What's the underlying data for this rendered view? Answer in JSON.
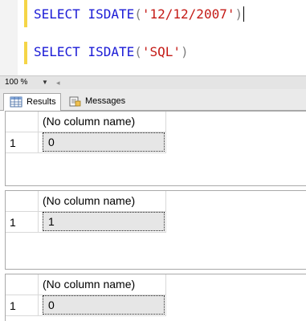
{
  "editor": {
    "line1": {
      "keyword": "SELECT",
      "func": "ISDATE",
      "open": "(",
      "arg": "'12/12/2007'",
      "close": ")"
    },
    "line2": {
      "keyword": "SELECT",
      "func": "ISDATE",
      "open": "(",
      "arg": "'SQL'",
      "close": ")"
    }
  },
  "zoom": {
    "value": "100 %"
  },
  "tabs": [
    {
      "label": "Results",
      "icon": "grid-icon"
    },
    {
      "label": "Messages",
      "icon": "messages-icon"
    }
  ],
  "results": [
    {
      "column_header": "(No column name)",
      "row_number": "1",
      "value": "0"
    },
    {
      "column_header": "(No column name)",
      "row_number": "1",
      "value": "1"
    },
    {
      "column_header": "(No column name)",
      "row_number": "1",
      "value": "0"
    }
  ],
  "colors": {
    "keyword": "#1a1ad6",
    "string": "#c41a16",
    "punctuation": "#808080",
    "change_marker": "#f5d547"
  }
}
